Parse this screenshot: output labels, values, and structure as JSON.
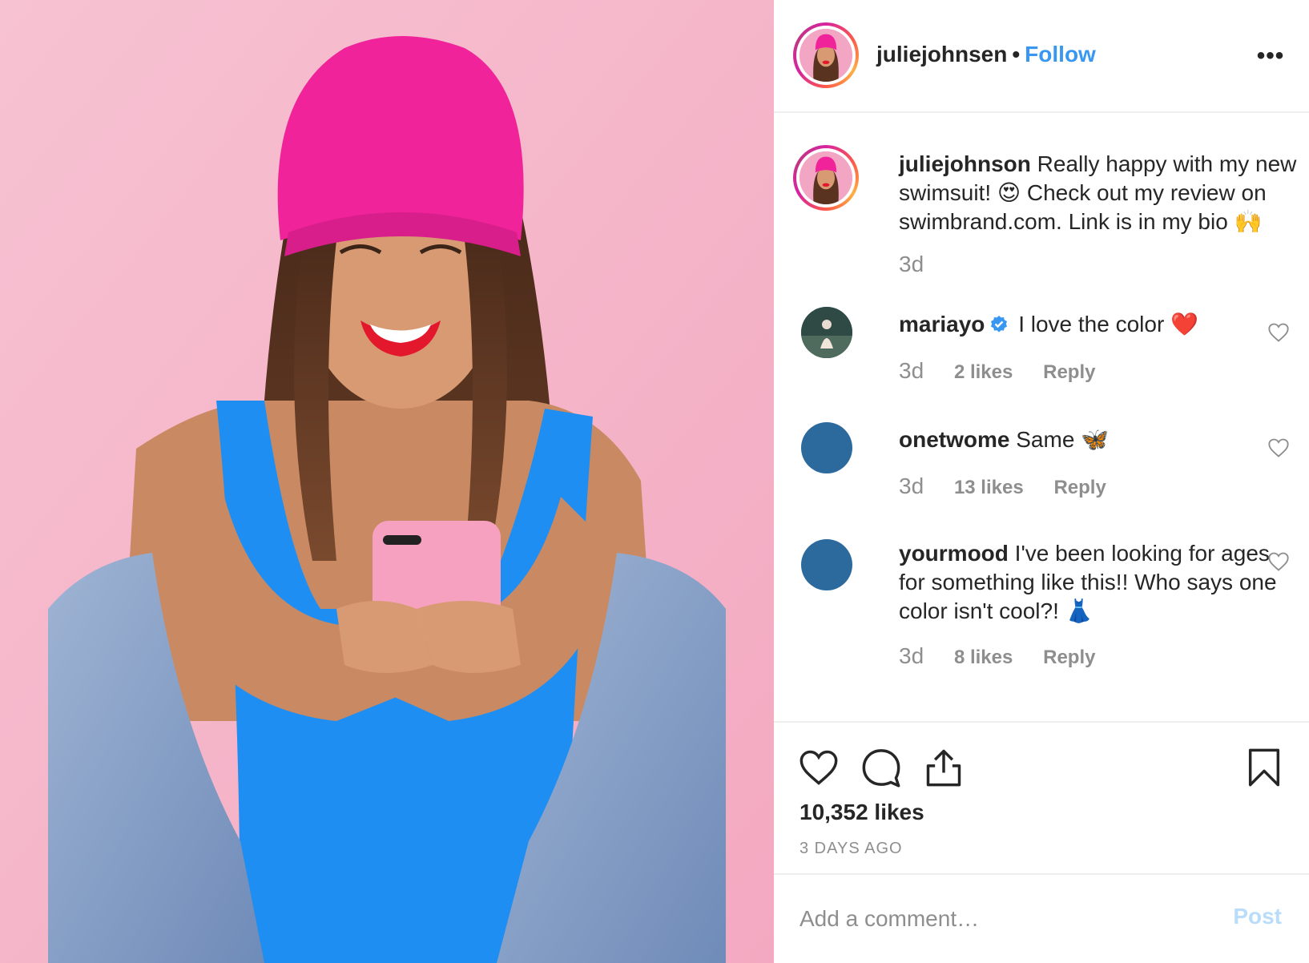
{
  "header": {
    "username": "juliejohnsen",
    "separator": "•",
    "follow_label": "Follow",
    "more_label": "•••"
  },
  "caption": {
    "username": "juliejohnson",
    "text": "Really happy with my new swimsuit! 😍  Check out my review on swimbrand.com. Link is in my bio 🙌",
    "time": "3d"
  },
  "comments": [
    {
      "username": "mariayo",
      "verified": true,
      "text": "I love the color ❤️",
      "time": "3d",
      "likes": "2 likes",
      "reply": "Reply"
    },
    {
      "username": "onetwome",
      "verified": false,
      "text": "Same 🦋",
      "time": "3d",
      "likes": "13 likes",
      "reply": "Reply"
    },
    {
      "username": "yourmood",
      "verified": false,
      "text": "I've been looking for ages for something like this!! Who says one color isn't cool?! 👗",
      "time": "3d",
      "likes": "8 likes",
      "reply": "Reply"
    }
  ],
  "actions": {
    "likes_count": "10,352 likes",
    "posted_time": "3 DAYS AGO",
    "icons": [
      "heart-icon",
      "comment-icon",
      "share-icon",
      "bookmark-icon"
    ]
  },
  "add_comment": {
    "placeholder": "Add a comment…",
    "post_label": "Post"
  },
  "colors": {
    "accent": "#3897f0",
    "muted": "#8e8e8e",
    "text": "#262626",
    "post_disabled": "#b9dcfb",
    "photo_background": "#f6b5c8",
    "beanie": "#f0239a",
    "top": "#1f8ef2",
    "avatar_default": "#2c6a9e"
  }
}
